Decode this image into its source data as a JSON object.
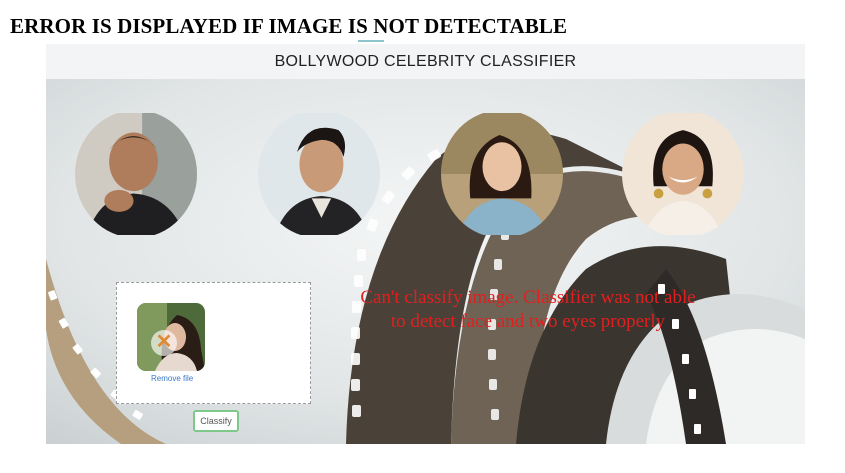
{
  "caption": "ERROR IS DISPLAYED IF IMAGE IS NOT DETECTABLE",
  "app": {
    "title": "BOLLYWOOD CELEBRITY CLASSIFIER"
  },
  "celebrities": [
    {
      "id": "celebrity-1"
    },
    {
      "id": "celebrity-2"
    },
    {
      "id": "celebrity-3"
    },
    {
      "id": "celebrity-4"
    }
  ],
  "upload": {
    "remove_label": "Remove file"
  },
  "classify_button": "Classify",
  "error": {
    "line1": "Can't classify image. Classifier was not able",
    "line2": "to detect face and two eyes properly"
  },
  "colors": {
    "error_text": "#e21f1f",
    "button_border": "#7ec98a",
    "link": "#3c78c8"
  }
}
